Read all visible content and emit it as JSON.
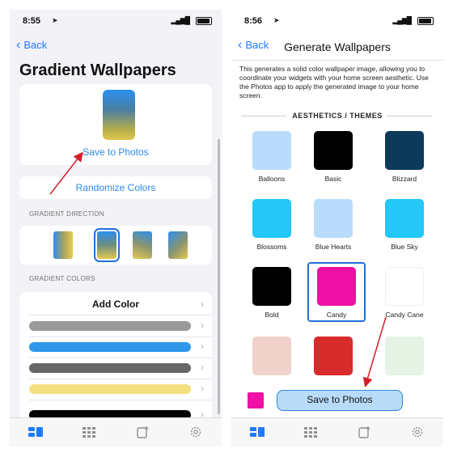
{
  "left": {
    "status": {
      "time": "8:55"
    },
    "back": "Back",
    "title": "Gradient Wallpapers",
    "save_label": "Save to Photos",
    "randomize_label": "Randomize Colors",
    "direction_header": "GRADIENT DIRECTION",
    "colors_header": "GRADIENT COLORS",
    "add_color": "Add Color",
    "color_bars": [
      "#9a9a9a",
      "#2f96ea",
      "#676767",
      "#f4e081",
      "#050505"
    ]
  },
  "right": {
    "status": {
      "time": "8:56"
    },
    "back": "Back",
    "title": "Generate Wallpapers",
    "description": "This generates a solid color wallpaper image, allowing you to coordinate your widgets with your home screen aesthetic. Use the Photos app to apply the generated image to your home screen.",
    "section": "AESTHETICS / THEMES",
    "themes": [
      {
        "name": "Balloons",
        "color": "#b9dcfb"
      },
      {
        "name": "Basic",
        "color": "#000000"
      },
      {
        "name": "Blizzard",
        "color": "#0b3a5a"
      },
      {
        "name": "Blossoms",
        "color": "#23c7f8"
      },
      {
        "name": "Blue Hearts",
        "color": "#b9dcfb"
      },
      {
        "name": "Blue Sky",
        "color": "#23c7f8"
      },
      {
        "name": "Bold",
        "color": "#000000"
      },
      {
        "name": "Candy",
        "color": "#ee0fa6"
      },
      {
        "name": "Candy Cane",
        "color": "#ffffff"
      },
      {
        "name": "",
        "color": "#f0d2cb"
      },
      {
        "name": "",
        "color": "#d82b2b"
      },
      {
        "name": "",
        "color": "#e4f3e4"
      }
    ],
    "selected_theme": "Candy",
    "save_label": "Save to Photos"
  },
  "colors": {
    "accent": "#1f7aff",
    "selection": "#1f6fd8",
    "annotation_arrow": "#d3202b"
  }
}
